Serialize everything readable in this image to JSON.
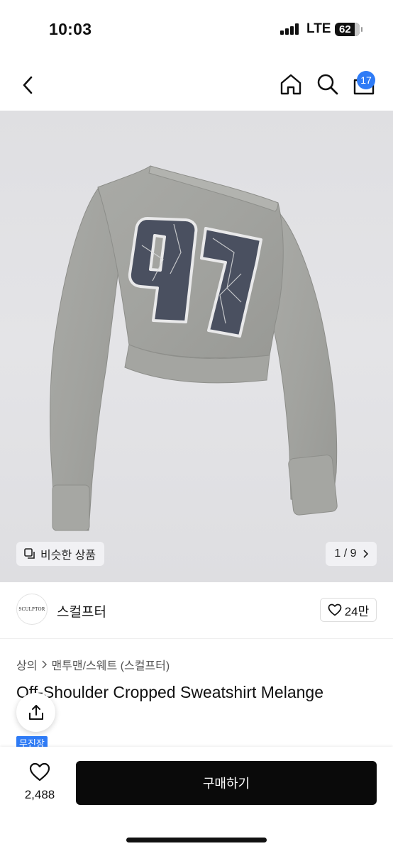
{
  "status_bar": {
    "time": "10:03",
    "network": "LTE",
    "battery": "62"
  },
  "nav": {
    "cart_count": "17",
    "icons": [
      "chevron-left-icon",
      "home-icon",
      "search-icon",
      "bag-icon"
    ]
  },
  "gallery": {
    "similar_label": "비슷한 상품",
    "pager": "1 / 9",
    "sweatshirt_print": "97"
  },
  "brand": {
    "logo_text": "SCULPTOR",
    "name": "스컬프터",
    "likes": "24만"
  },
  "product": {
    "breadcrumb_category": "상의",
    "breadcrumb_sub": "맨투맨/스웨트 (스컬프터)",
    "title": "Off-Shoulder Cropped Sweatshirt Melange",
    "tag": "무진장"
  },
  "bottom": {
    "wish_count": "2,488",
    "buy_label": "구매하기"
  },
  "colors": {
    "accent": "#2e7bf6",
    "buy_button": "#0a0a0a",
    "print": "#4a5060"
  }
}
